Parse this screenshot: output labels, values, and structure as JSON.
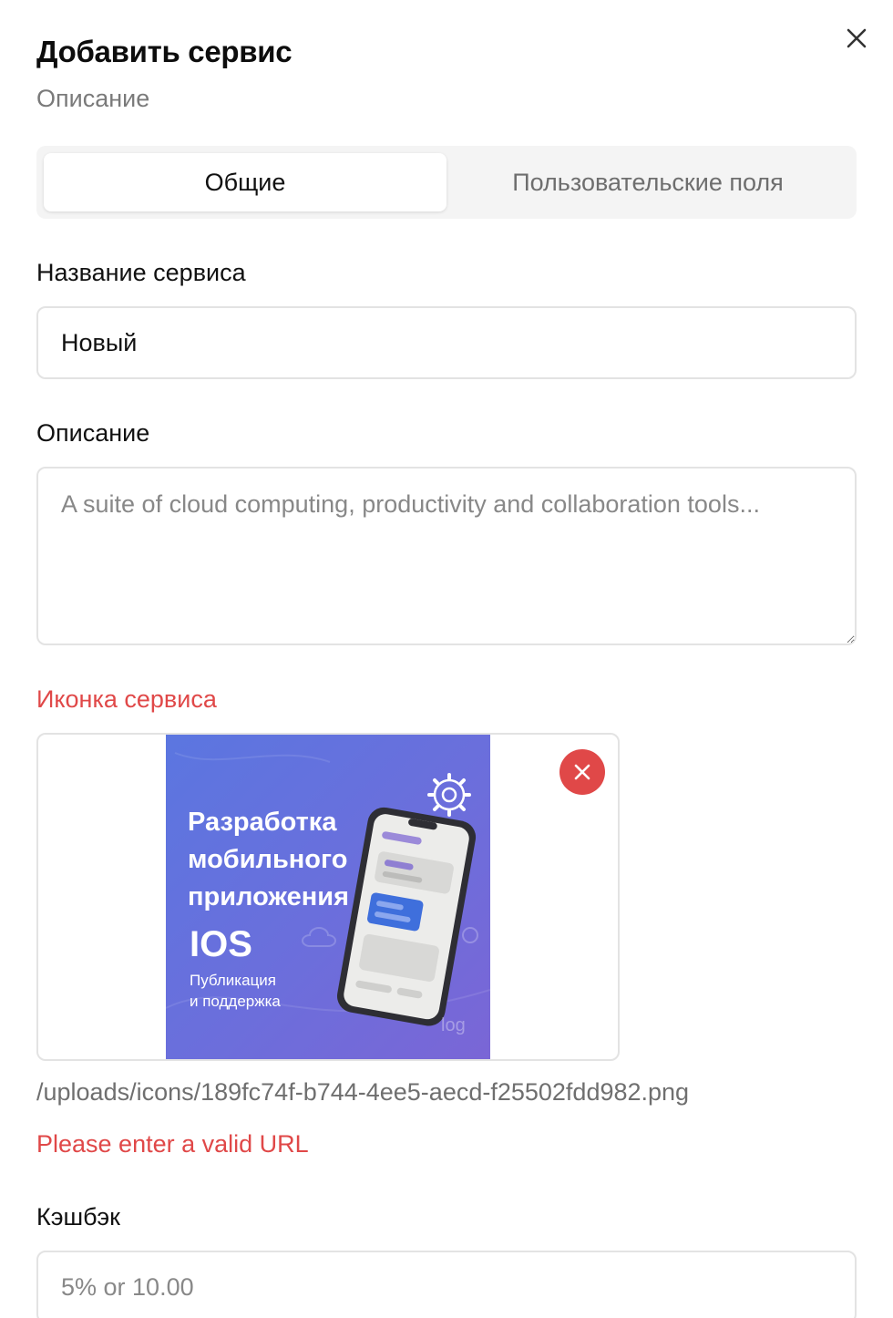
{
  "modal": {
    "title": "Добавить сервис",
    "subtitle": "Описание",
    "close_icon": "close-icon"
  },
  "tabs": [
    {
      "label": "Общие",
      "active": true
    },
    {
      "label": "Пользовательские поля",
      "active": false
    }
  ],
  "form": {
    "name": {
      "label": "Название сервиса",
      "value": "Новый"
    },
    "description": {
      "label": "Описание",
      "value": "",
      "placeholder": "A suite of cloud computing, productivity and collaboration tools..."
    },
    "icon": {
      "label": "Иконка сервиса",
      "file_path": "/uploads/icons/189fc74f-b744-4ee5-aecd-f25502fdd982.png",
      "error": "Please enter a valid URL",
      "remove_icon": "close-icon",
      "preview": {
        "title": "Разработка мобильного приложения",
        "platform": "IOS",
        "subtitle_line1": "Публикация",
        "subtitle_line2": "и поддержка",
        "watermark": "log"
      }
    },
    "cashback": {
      "label": "Кэшбэк",
      "value": "",
      "placeholder": "5% or 10.00"
    }
  },
  "colors": {
    "error": "#e04848",
    "tab_bg": "#f4f4f4",
    "border": "#e3e3e3",
    "preview_gradient_start": "#5b76e0",
    "preview_gradient_end": "#7a66d6"
  }
}
